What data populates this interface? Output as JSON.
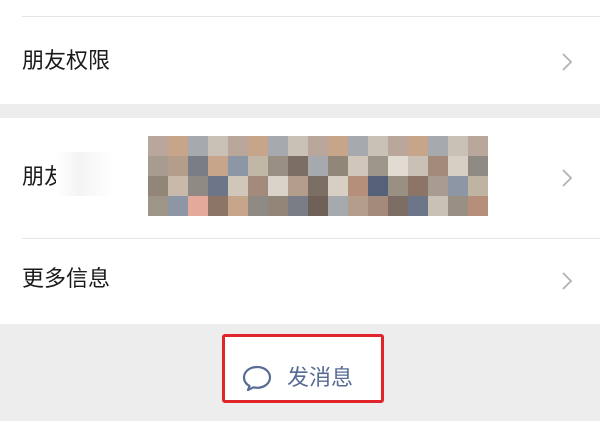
{
  "rows": {
    "friend_permissions": "朋友权限",
    "moments": "朋友",
    "more_info": "更多信息"
  },
  "icons": {
    "row_chevron": "chevron-right-icon",
    "send_bubble": "chat-bubble-icon"
  },
  "send_button": {
    "label": "发消息"
  },
  "colors": {
    "link": "#576b95",
    "highlight_border": "#e0242a",
    "background": "#ededed",
    "chevron": "#b2b2b2"
  }
}
